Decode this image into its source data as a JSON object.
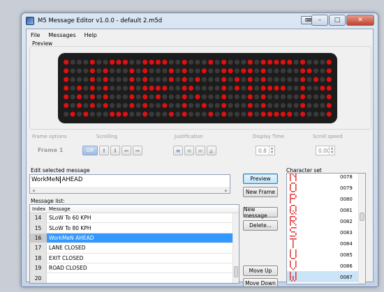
{
  "window": {
    "title": "M5 Message Editor v1.0.0 - default 2.m5d",
    "controls": {
      "minimize": "–",
      "maximize": "□",
      "close": "✕"
    }
  },
  "menu": [
    "File",
    "Messages",
    "Help"
  ],
  "preview": {
    "label": "Preview",
    "text": "WORKMEN",
    "led_color": "#e01010",
    "led_off_color": "#3a3a3a"
  },
  "options": {
    "frame_options_label": "Frame options",
    "scrolling_label": "Scrolling",
    "justification_label": "Justification",
    "display_time_label": "Display Time",
    "scroll_speed_label": "Scroll speed",
    "frame_label": "Frame 1",
    "off_label": "Off",
    "display_time_value": "0.8",
    "scroll_speed_value": "0.00"
  },
  "edit": {
    "label": "Edit selected message",
    "before_cursor": "WorkMeN",
    "after_cursor": "AHEAD"
  },
  "buttons": {
    "preview": "Preview",
    "new_frame": "New Frame",
    "new_message": "New message",
    "delete": "Delete...",
    "move_up": "Move Up",
    "move_down": "Move Down"
  },
  "message_list": {
    "label": "Message list:",
    "columns": [
      "Index",
      "Message"
    ],
    "rows": [
      {
        "index": "14",
        "message": "SLoW To 60 KPH",
        "selected": false
      },
      {
        "index": "15",
        "message": "SLoW To 80 KPH",
        "selected": false
      },
      {
        "index": "16",
        "message": "WorkMeN AHEAD",
        "selected": true
      },
      {
        "index": "17",
        "message": "LANE CLOSED",
        "selected": false
      },
      {
        "index": "18",
        "message": "EXIT CLOSED",
        "selected": false
      },
      {
        "index": "19",
        "message": "ROAD CLOSED",
        "selected": false
      },
      {
        "index": "20",
        "message": "",
        "selected": false
      }
    ]
  },
  "charset": {
    "label": "Character set",
    "items": [
      {
        "code": "0078",
        "char": "N"
      },
      {
        "code": "0079",
        "char": "O"
      },
      {
        "code": "0080",
        "char": "P"
      },
      {
        "code": "0081",
        "char": "Q"
      },
      {
        "code": "0082",
        "char": "R"
      },
      {
        "code": "0083",
        "char": "S"
      },
      {
        "code": "0084",
        "char": "T"
      },
      {
        "code": "0085",
        "char": "U"
      },
      {
        "code": "0086",
        "char": "V"
      },
      {
        "code": "0087",
        "char": "W"
      }
    ],
    "selected_code": "0087"
  }
}
